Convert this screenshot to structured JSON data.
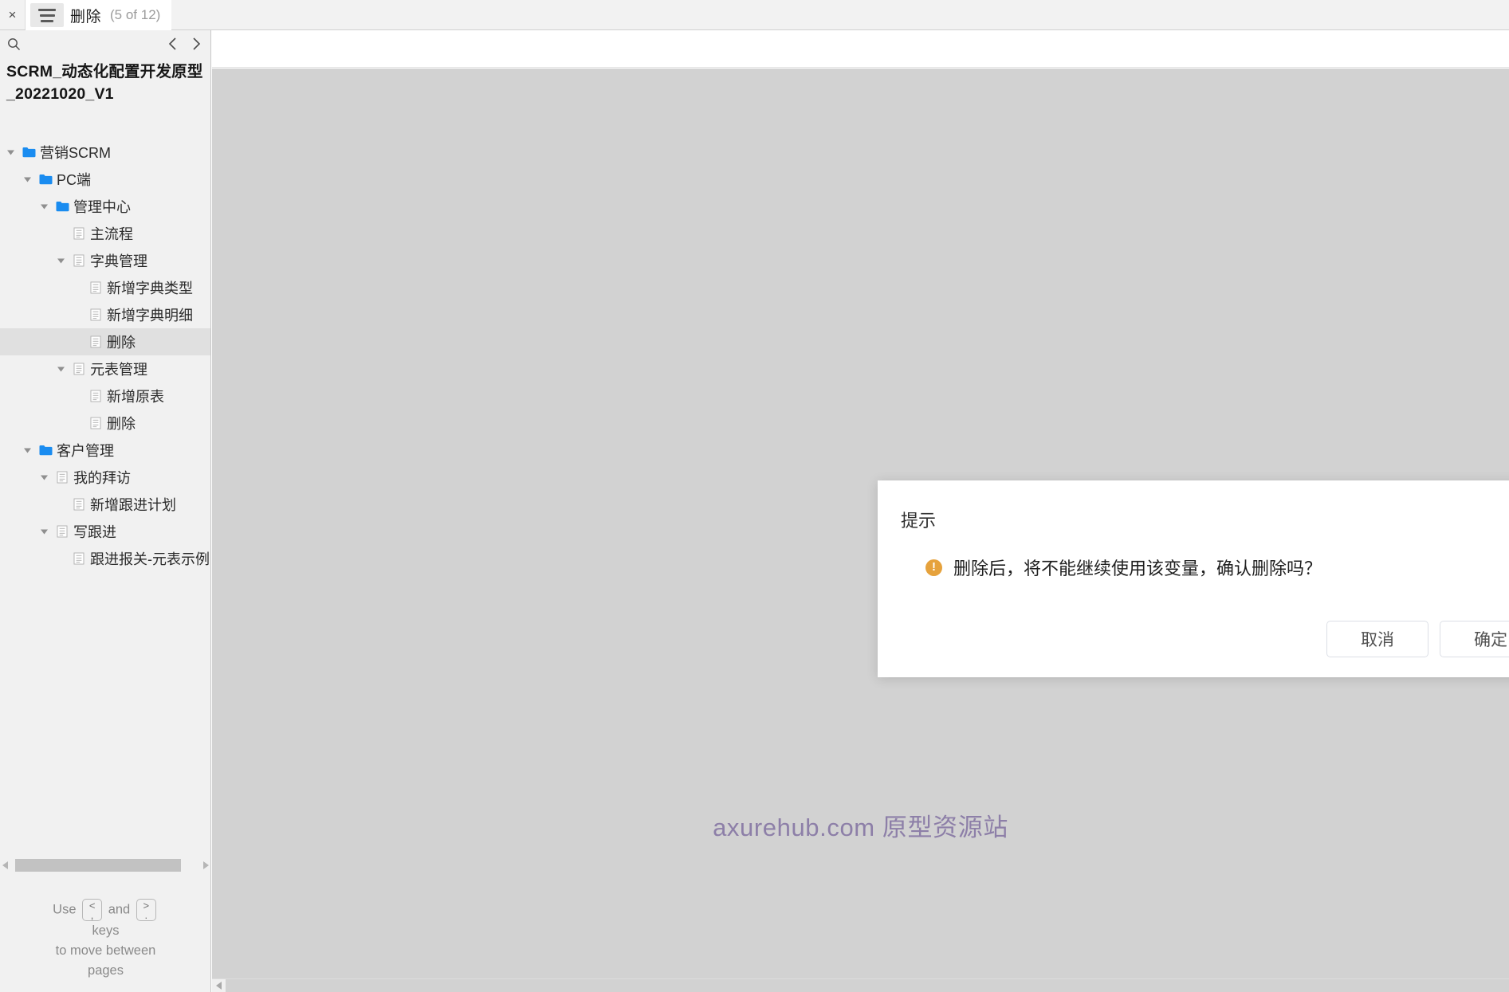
{
  "topbar": {
    "close_label": "×",
    "menu_icon": "hamburger-icon",
    "page_title": "删除",
    "page_count": "(5 of 12)"
  },
  "sidebar": {
    "search_icon": "search-icon",
    "prev_icon": "chevron-left-icon",
    "next_icon": "chevron-right-icon",
    "project_name": "SCRM_动态化配置开发原型_20221020_V1",
    "tree": [
      {
        "label": "营销SCRM",
        "depth": 0,
        "type": "folder",
        "arrow": "down",
        "selected": false
      },
      {
        "label": "PC端",
        "depth": 1,
        "type": "folder",
        "arrow": "down",
        "selected": false
      },
      {
        "label": "管理中心",
        "depth": 2,
        "type": "folder",
        "arrow": "down",
        "selected": false
      },
      {
        "label": "主流程",
        "depth": 3,
        "type": "page",
        "arrow": "none",
        "selected": false
      },
      {
        "label": "字典管理",
        "depth": 3,
        "type": "page",
        "arrow": "down",
        "selected": false
      },
      {
        "label": "新增字典类型",
        "depth": 4,
        "type": "page",
        "arrow": "none",
        "selected": false
      },
      {
        "label": "新增字典明细",
        "depth": 4,
        "type": "page",
        "arrow": "none",
        "selected": false
      },
      {
        "label": "删除",
        "depth": 4,
        "type": "page",
        "arrow": "none",
        "selected": true
      },
      {
        "label": "元表管理",
        "depth": 3,
        "type": "page",
        "arrow": "down",
        "selected": false
      },
      {
        "label": "新增原表",
        "depth": 4,
        "type": "page",
        "arrow": "none",
        "selected": false
      },
      {
        "label": "删除",
        "depth": 4,
        "type": "page",
        "arrow": "none",
        "selected": false
      },
      {
        "label": "客户管理",
        "depth": 1,
        "type": "folder",
        "arrow": "down",
        "selected": false
      },
      {
        "label": "我的拜访",
        "depth": 2,
        "type": "page",
        "arrow": "down",
        "selected": false
      },
      {
        "label": "新增跟进计划",
        "depth": 3,
        "type": "page",
        "arrow": "none",
        "selected": false
      },
      {
        "label": "写跟进",
        "depth": 2,
        "type": "page",
        "arrow": "down",
        "selected": false
      },
      {
        "label": "跟进报关-元表示例",
        "depth": 3,
        "type": "page",
        "arrow": "none",
        "selected": false
      }
    ],
    "hint": {
      "lead": "Use",
      "key_prev_top": "<",
      "key_prev_bottom": ",",
      "middle": "and",
      "key_next_top": ">",
      "key_next_bottom": ".",
      "line2": "keys",
      "line3": "to move between",
      "line4": "pages"
    },
    "scroll_left_icon": "triangle-left-icon",
    "scroll_right_icon": "triangle-right-icon"
  },
  "main": {
    "watermark": "axurehub.com 原型资源站",
    "watermark_color": "#8d7fa8",
    "canvas_color": "#d2d2d2",
    "scroll_left_icon": "triangle-left-icon"
  },
  "dialog": {
    "title": "提示",
    "warn_icon": "warning-icon",
    "warn_color": "#e6a23c",
    "message": "删除后，将不能继续使用该变量，确认删除吗？",
    "cancel_label": "取消",
    "confirm_label": "确定"
  }
}
